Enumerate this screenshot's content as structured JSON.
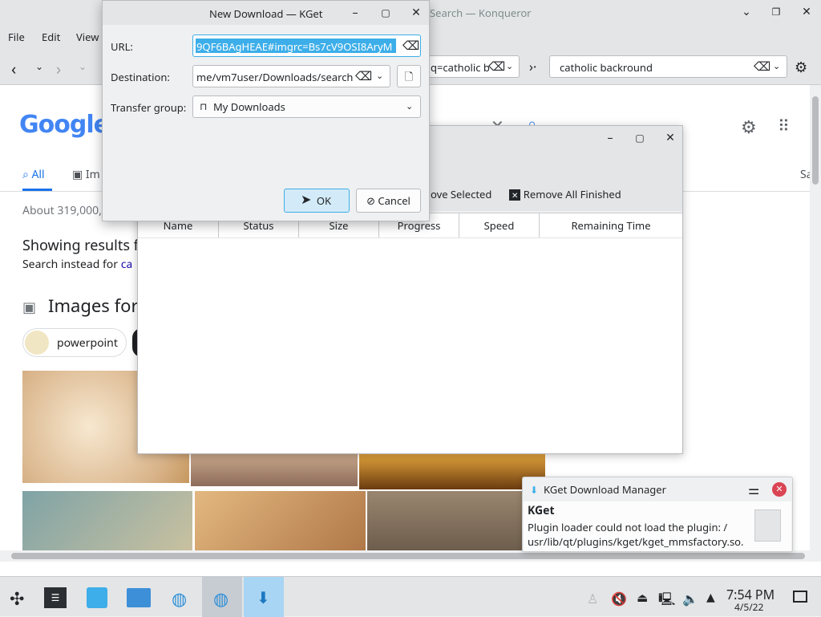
{
  "konqueror": {
    "title": "Search — Konqueror",
    "menu": [
      "File",
      "Edit",
      "View"
    ],
    "location_text": "q=catholic b",
    "search_text": "catholic backround",
    "google": {
      "logo": "Google",
      "tabs": [
        "All",
        "Im"
      ],
      "right_tab": "Sa",
      "about": "About 319,000,",
      "showing": "Showing results f",
      "search_instead_prefix": "Search instead for ",
      "search_instead_link": "ca",
      "images_for": "Images for",
      "chip": "powerpoint"
    }
  },
  "kget": {
    "toolbar": {
      "remove_selected": "ove Selected",
      "remove_finished": "Remove All Finished"
    },
    "columns": [
      "Name",
      "Status",
      "Size",
      "Progress",
      "Speed",
      "Remaining Time"
    ]
  },
  "dialog": {
    "title": "New Download — KGet",
    "url_label": "URL:",
    "url_value": "9QF6BAgHEAE#imgrc=Bs7cV9OSI8AryM",
    "destination_label": "Destination:",
    "destination_value": "me/vm7user/Downloads/search",
    "group_label": "Transfer group:",
    "group_value": "My Downloads",
    "ok": "OK",
    "cancel": "Cancel"
  },
  "notification": {
    "app": "KGet Download Manager",
    "title": "KGet",
    "body_line1": "Plugin loader could not load the plugin: /",
    "body_line2": "usr/lib/qt/plugins/kget/kget_mmsfactory.so."
  },
  "taskbar": {
    "time": "7:54 PM",
    "date": "4/5/22"
  },
  "colors": {
    "accent": "#3daee9",
    "selection": "#3daee9",
    "close_red": "#da4453"
  }
}
